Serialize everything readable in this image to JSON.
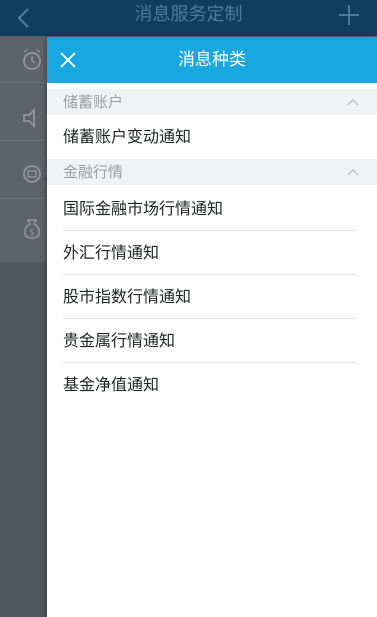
{
  "background_page": {
    "title": "消息服务定制",
    "icons": [
      "alarm-clock-icon",
      "speaker-icon",
      "wallet-icon",
      "money-bag-icon"
    ]
  },
  "drawer": {
    "title": "消息种类",
    "close_icon": "close-icon",
    "sections": [
      {
        "label": "储蓄账户",
        "items": [
          {
            "label": "储蓄账户变动通知"
          }
        ]
      },
      {
        "label": "金融行情",
        "items": [
          {
            "label": "国际金融市场行情通知"
          },
          {
            "label": "外汇行情通知"
          },
          {
            "label": "股市指数行情通知"
          },
          {
            "label": "贵金属行情通知"
          },
          {
            "label": "基金净值通知"
          }
        ]
      }
    ]
  },
  "colors": {
    "accent": "#19a7e0",
    "dimmed_header": "#0e3f5f",
    "section_bg": "#f1f2f4",
    "section_text": "#9ba0a6",
    "item_text": "#222426"
  }
}
